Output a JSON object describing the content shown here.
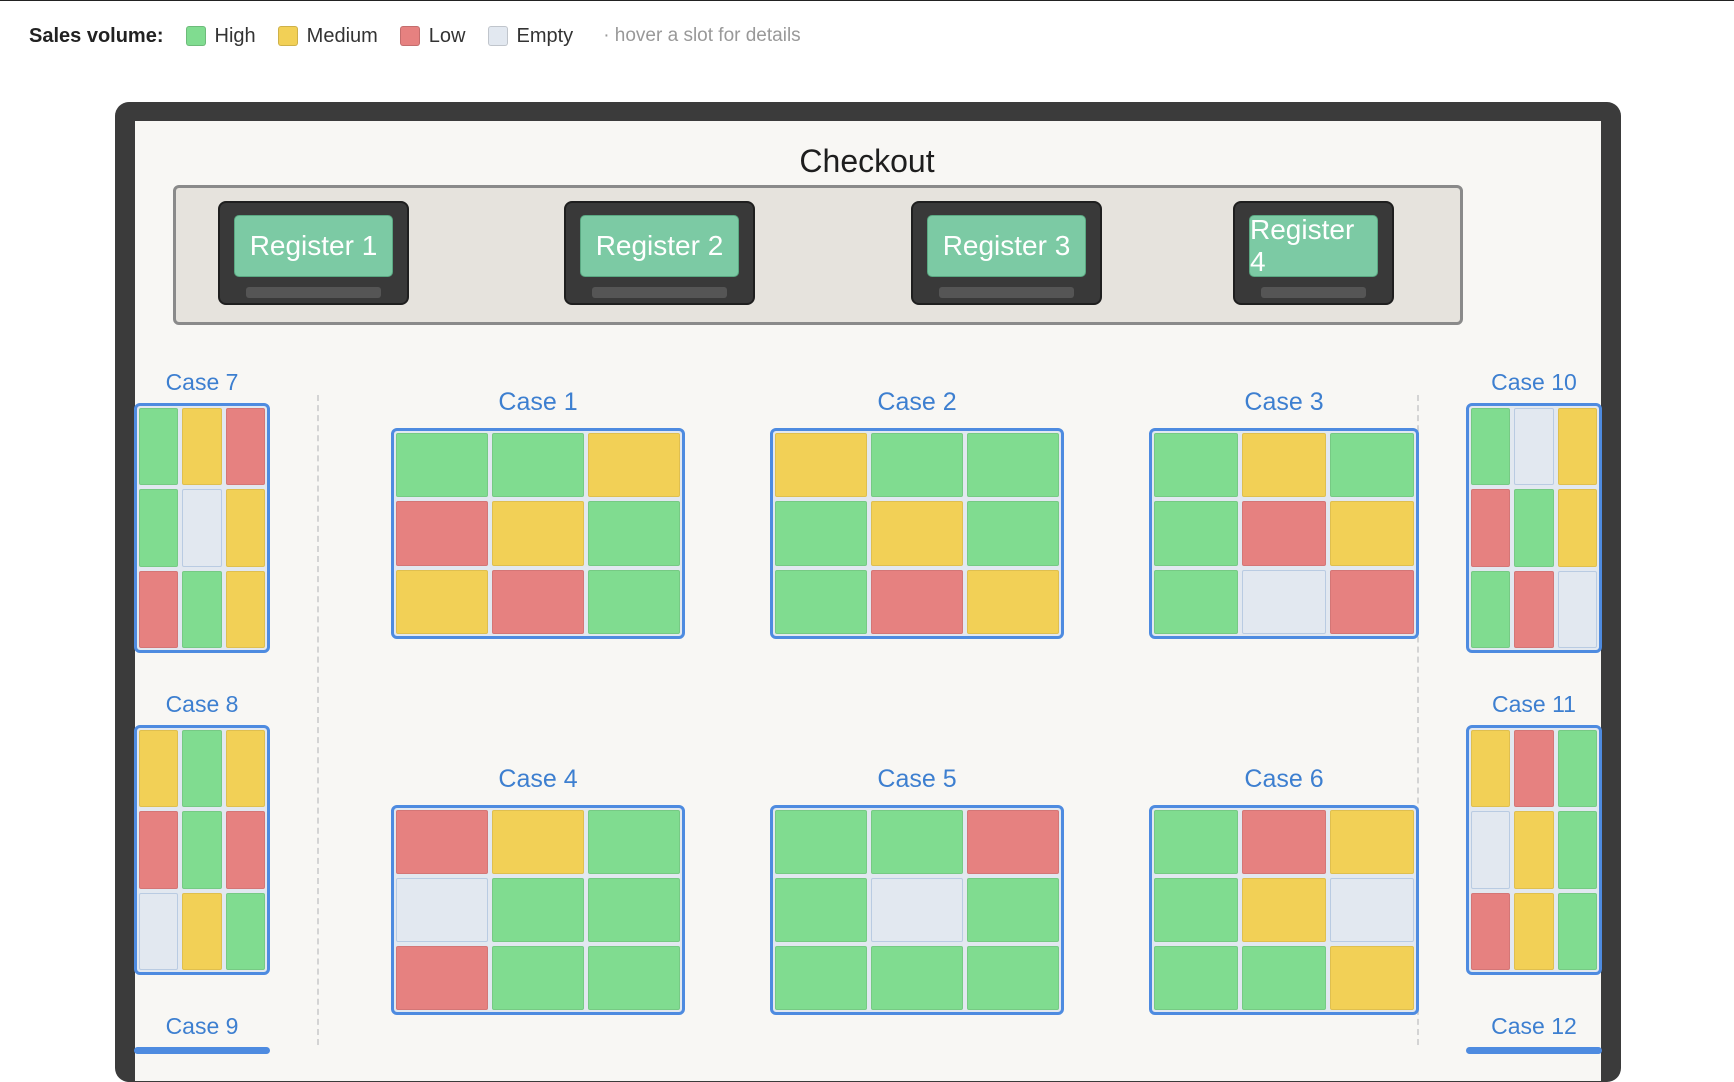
{
  "legend": {
    "title": "Sales volume:",
    "items": [
      {
        "key": "high",
        "label": "High",
        "color": "#80dc90"
      },
      {
        "key": "medium",
        "label": "Medium",
        "color": "#f2d056"
      },
      {
        "key": "low",
        "label": "Low",
        "color": "#e68180"
      },
      {
        "key": "empty",
        "label": "Empty",
        "color": "#e2e8f0"
      }
    ],
    "hint": "· hover a slot for details"
  },
  "checkout": {
    "title": "Checkout",
    "registers": [
      "Register 1",
      "Register 2",
      "Register 3",
      "Register 4"
    ]
  },
  "colors": {
    "case_border": "#4e8be0",
    "case_label": "#3d7fd0",
    "register_screen": "#7ccaa4",
    "store_wall": "#3b3b3b"
  },
  "cases": [
    {
      "label": "Case 1",
      "slots": [
        "high",
        "high",
        "medium",
        "low",
        "medium",
        "high",
        "medium",
        "low",
        "high"
      ]
    },
    {
      "label": "Case 2",
      "slots": [
        "medium",
        "high",
        "high",
        "high",
        "medium",
        "high",
        "high",
        "low",
        "medium"
      ]
    },
    {
      "label": "Case 3",
      "slots": [
        "high",
        "medium",
        "high",
        "high",
        "low",
        "medium",
        "high",
        "empty",
        "low"
      ]
    },
    {
      "label": "Case 4",
      "slots": [
        "low",
        "medium",
        "high",
        "empty",
        "high",
        "high",
        "low",
        "high",
        "high"
      ]
    },
    {
      "label": "Case 5",
      "slots": [
        "high",
        "high",
        "low",
        "high",
        "empty",
        "high",
        "high",
        "high",
        "high"
      ]
    },
    {
      "label": "Case 6",
      "slots": [
        "high",
        "low",
        "medium",
        "high",
        "medium",
        "empty",
        "high",
        "high",
        "medium"
      ]
    },
    {
      "label": "Case 7",
      "slots": [
        "high",
        "medium",
        "low",
        "high",
        "empty",
        "medium",
        "low",
        "high",
        "medium"
      ]
    },
    {
      "label": "Case 8",
      "slots": [
        "medium",
        "high",
        "medium",
        "low",
        "high",
        "low",
        "empty",
        "medium",
        "high"
      ]
    },
    {
      "label": "Case 9",
      "slots": []
    },
    {
      "label": "Case 10",
      "slots": [
        "high",
        "empty",
        "medium",
        "low",
        "high",
        "medium",
        "high",
        "low",
        "empty"
      ]
    },
    {
      "label": "Case 11",
      "slots": [
        "medium",
        "low",
        "high",
        "empty",
        "medium",
        "high",
        "low",
        "medium",
        "high"
      ]
    },
    {
      "label": "Case 12",
      "slots": []
    }
  ]
}
